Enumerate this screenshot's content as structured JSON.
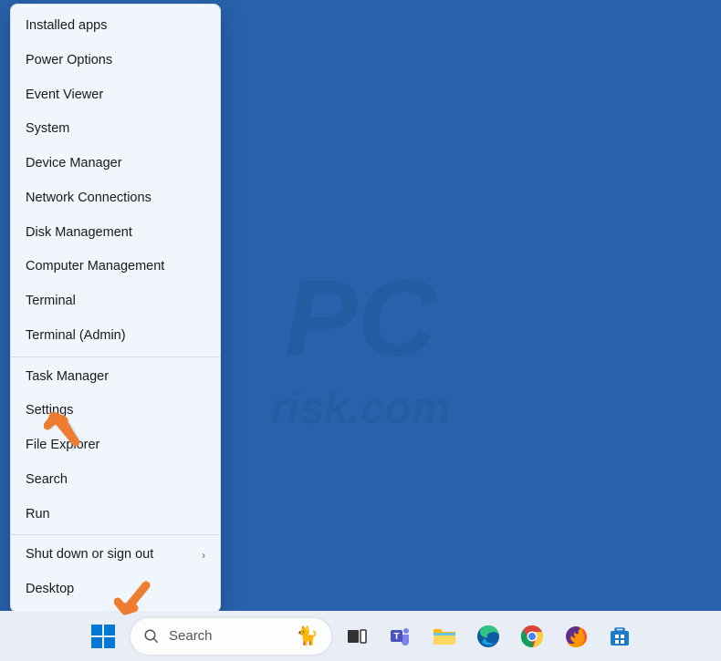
{
  "watermark": {
    "main": "PC",
    "sub": "risk.com"
  },
  "contextMenu": {
    "group1": [
      {
        "label": "Installed apps"
      },
      {
        "label": "Power Options"
      },
      {
        "label": "Event Viewer"
      },
      {
        "label": "System"
      },
      {
        "label": "Device Manager"
      },
      {
        "label": "Network Connections"
      },
      {
        "label": "Disk Management"
      },
      {
        "label": "Computer Management"
      },
      {
        "label": "Terminal"
      },
      {
        "label": "Terminal (Admin)"
      }
    ],
    "group2": [
      {
        "label": "Task Manager"
      },
      {
        "label": "Settings"
      },
      {
        "label": "File Explorer"
      },
      {
        "label": "Search"
      },
      {
        "label": "Run"
      }
    ],
    "group3": [
      {
        "label": "Shut down or sign out",
        "submenu": true
      },
      {
        "label": "Desktop"
      }
    ]
  },
  "taskbar": {
    "searchPlaceholder": "Search",
    "icons": {
      "start": "start",
      "taskview": "task-view",
      "teams": "teams",
      "explorer": "file-explorer",
      "edge": "edge",
      "chrome": "chrome",
      "firefox": "firefox",
      "store": "microsoft-store"
    }
  }
}
